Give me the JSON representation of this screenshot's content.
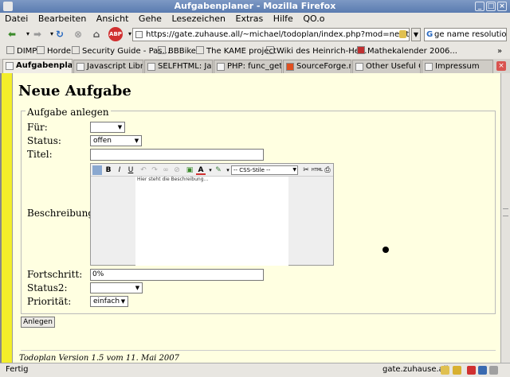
{
  "window": {
    "title": "Aufgabenplaner - Mozilla Firefox"
  },
  "menu": [
    "Datei",
    "Bearbeiten",
    "Ansicht",
    "Gehe",
    "Lesezeichen",
    "Extras",
    "Hilfe",
    "QO.o"
  ],
  "nav": {
    "url": "https://gate.zuhause.all/~michael/todoplan/index.php?mod=newtask",
    "search_value": "ge name resolution"
  },
  "bookmarks": [
    "DIMP",
    "Horde",
    "Security Guide - Pas...",
    "BBBike",
    "The KAME project",
    "Wiki des Heinrich-He...",
    "Mathekalender 2006..."
  ],
  "tabs": [
    "Aufgabenpla...",
    "Javascript Libra...",
    "SELFHTML: Jav...",
    "PHP: func_get_...",
    "SourceForge.n...",
    "Other Useful C...",
    "Impressum"
  ],
  "page": {
    "heading": "Neue Aufgabe",
    "legend": "Aufgabe anlegen",
    "labels": {
      "fuer": "Für:",
      "status": "Status:",
      "titel": "Titel:",
      "beschreibung": "Beschreibung:",
      "fortschritt": "Fortschritt:",
      "status2": "Status2:",
      "prioritaet": "Priorität:"
    },
    "values": {
      "fuer": "",
      "status": "offen",
      "titel": "",
      "fortschritt": "0%",
      "status2": "",
      "prioritaet": "einfach"
    },
    "editor": {
      "css_style": "-- CSS-Stile --",
      "placeholder": "Hier steht die Beschreibung..."
    },
    "submit_label": "Anlegen",
    "footer": "Todoplan Version 1.5 vom 11. Mai 2007"
  },
  "status": {
    "text": "Fertig",
    "host": "gate.zuhause.all"
  }
}
